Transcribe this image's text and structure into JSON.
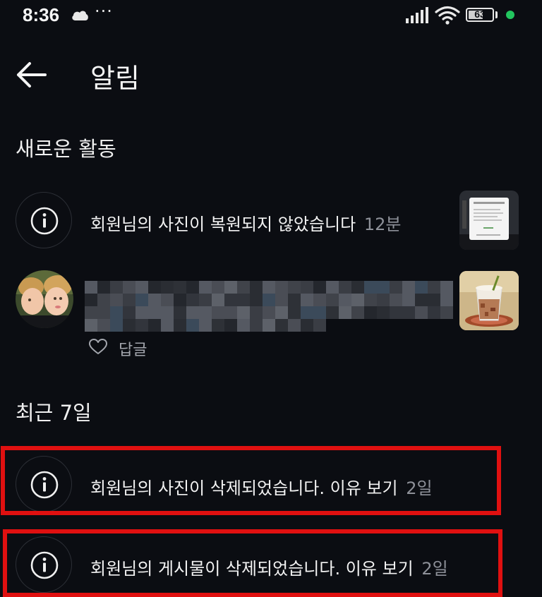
{
  "status_bar": {
    "time": "8:36",
    "left_icons": [
      "cloud-icon",
      "more-dots-icon"
    ],
    "more_dots": "···",
    "battery_level": "63",
    "battery_fill_fraction": 0.63,
    "right_icons": [
      "signal-icon",
      "wifi-icon",
      "battery-icon",
      "green-indicator-dot"
    ],
    "indicator_color": "#22c55e"
  },
  "header": {
    "back_icon": "back-arrow-icon",
    "title": "알림"
  },
  "sections": {
    "new_activity": {
      "heading": "새로운 활동",
      "items": [
        {
          "icon": "info-icon",
          "text": "회원님의 사진이 복원되지 않았습니다",
          "time": "12분",
          "thumbnail": "screenshot-thumbnail"
        },
        {
          "avatar": "kids-photo-avatar",
          "text_pixelated": true,
          "reply_label": "답글",
          "thumbnail": "drink-cup-thumbnail"
        }
      ]
    },
    "recent_7_days": {
      "heading": "최근 7일",
      "items": [
        {
          "icon": "info-icon",
          "text": "회원님의 사진이 삭제되었습니다. 이유 보기",
          "time": "2일",
          "highlighted": true
        },
        {
          "icon": "info-icon",
          "text": "회원님의 게시물이 삭제되었습니다. 이유 보기",
          "time": "2일",
          "highlighted": true
        }
      ]
    }
  },
  "colors": {
    "background": "#0b0d12",
    "primary_text": "#f2f2f2",
    "muted_text": "#8e9199",
    "highlight": "#e01010"
  }
}
